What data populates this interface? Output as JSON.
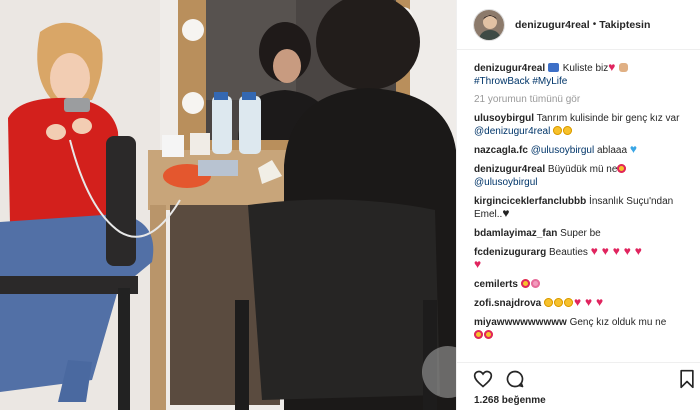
{
  "header": {
    "username": "denizugur4real",
    "separator": "•",
    "follow_status": "Takiptesin"
  },
  "caption": {
    "username": "denizugur4real",
    "text": "Kuliste biz",
    "hashtags": "#ThrowBack #MyLife"
  },
  "view_all_comments": "21 yorumun tümünü gör",
  "comments": [
    {
      "username": "ulusoybirgul",
      "text": "Tanrım kulisinde bir genç kız var",
      "mention": "@denizugur4real"
    },
    {
      "username": "nazcagla.fc",
      "mention": "@ulusoybirgul",
      "text": "ablaaa"
    },
    {
      "username": "denizugur4real",
      "text": "Büyüdük mü ne",
      "mention": "@ulusoybirgul"
    },
    {
      "username": "kirginciceklerfanclubbb",
      "text": "İnsanlık Suçu'ndan Emel.."
    },
    {
      "username": "bdamlayimaz_fan",
      "text": "Super be"
    },
    {
      "username": "fcdenizugurarg",
      "text": "Beauties"
    },
    {
      "username": "cemilerts",
      "text": ""
    },
    {
      "username": "zofi.snajdrova",
      "text": ""
    },
    {
      "username": "miyawwwwwwwww",
      "text": "Genç kız olduk mu ne"
    }
  ],
  "likes": "1.268 beğenme",
  "icons": {
    "like": "heart-outline-icon",
    "comment": "speech-bubble-icon",
    "save": "bookmark-icon"
  }
}
